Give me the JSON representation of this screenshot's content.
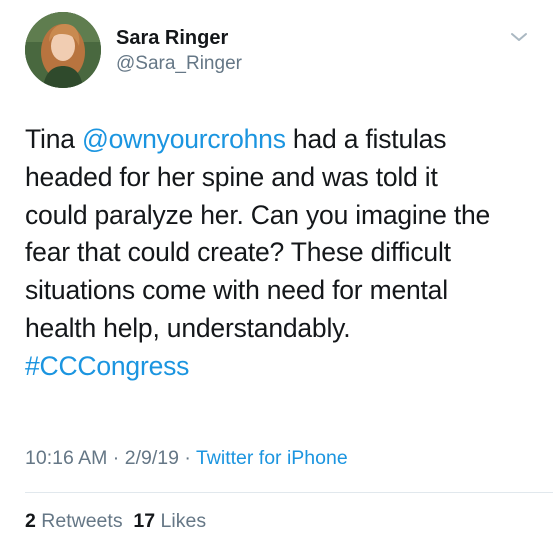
{
  "author": {
    "display_name": "Sara Ringer",
    "handle": "@Sara_Ringer",
    "avatar_icon": "profile-photo"
  },
  "menu_icon": "chevron-down-icon",
  "tweet": {
    "lines": [
      {
        "pre": "Tina ",
        "link": "@ownyourcrohns",
        "post": " had a fistulas"
      },
      {
        "text": "headed for her spine and was told it"
      },
      {
        "text": "could paralyze her. Can you imagine the"
      },
      {
        "text": "fear that could create? These difficult"
      },
      {
        "text": "situations come with need for mental"
      },
      {
        "text": "health help, understandably."
      },
      {
        "hashtag": "#CCCongress"
      }
    ]
  },
  "meta": {
    "time": "10:16 AM",
    "sep1": " · ",
    "date": "2/9/19",
    "sep2": " · ",
    "source": "Twitter for iPhone"
  },
  "stats": {
    "retweets_count": "2",
    "retweets_label": "Retweets",
    "likes_count": "17",
    "likes_label": "Likes"
  },
  "colors": {
    "link": "#1b95e0",
    "secondary_text": "#657786",
    "primary_text": "#14171a",
    "divider": "#e1e8ed"
  }
}
